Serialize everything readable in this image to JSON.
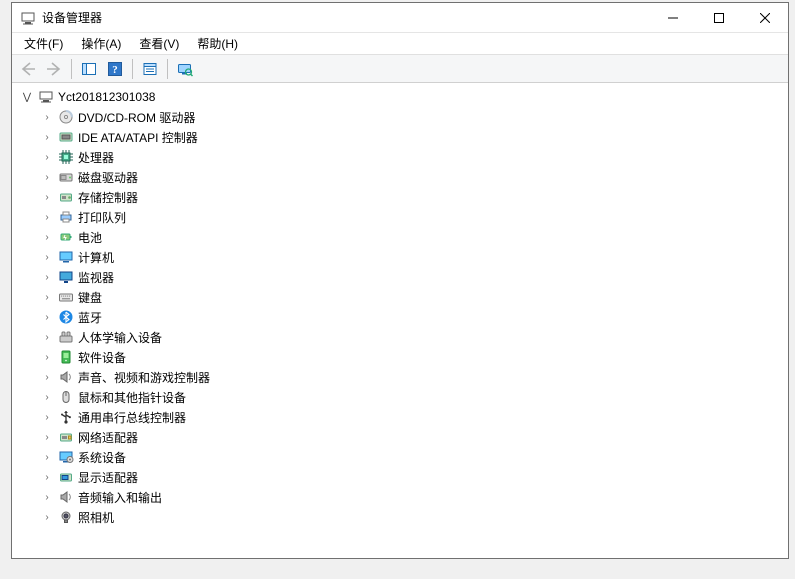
{
  "window": {
    "title": "设备管理器"
  },
  "menu": {
    "file": "文件(F)",
    "action": "操作(A)",
    "view": "查看(V)",
    "help": "帮助(H)"
  },
  "tree": {
    "root": "Yct201812301038",
    "items": [
      {
        "icon": "disc-icon",
        "label": "DVD/CD-ROM 驱动器"
      },
      {
        "icon": "ide-icon",
        "label": "IDE ATA/ATAPI 控制器"
      },
      {
        "icon": "cpu-icon",
        "label": "处理器"
      },
      {
        "icon": "disk-icon",
        "label": "磁盘驱动器"
      },
      {
        "icon": "storage-icon",
        "label": "存储控制器"
      },
      {
        "icon": "printer-icon",
        "label": "打印队列"
      },
      {
        "icon": "battery-icon",
        "label": "电池"
      },
      {
        "icon": "computer-icon",
        "label": "计算机"
      },
      {
        "icon": "monitor-icon",
        "label": "监视器"
      },
      {
        "icon": "keyboard-icon",
        "label": "键盘"
      },
      {
        "icon": "bluetooth-icon",
        "label": "蓝牙"
      },
      {
        "icon": "hid-icon",
        "label": "人体学输入设备"
      },
      {
        "icon": "software-icon",
        "label": "软件设备"
      },
      {
        "icon": "sound-icon",
        "label": "声音、视频和游戏控制器"
      },
      {
        "icon": "mouse-icon",
        "label": "鼠标和其他指针设备"
      },
      {
        "icon": "usb-icon",
        "label": "通用串行总线控制器"
      },
      {
        "icon": "network-icon",
        "label": "网络适配器"
      },
      {
        "icon": "system-icon",
        "label": "系统设备"
      },
      {
        "icon": "display-icon",
        "label": "显示适配器"
      },
      {
        "icon": "audio-icon",
        "label": "音频输入和输出"
      },
      {
        "icon": "camera-icon",
        "label": "照相机"
      }
    ]
  }
}
